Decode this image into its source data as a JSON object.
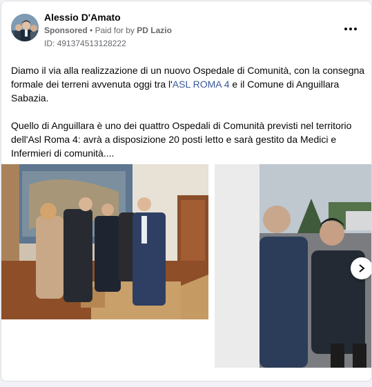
{
  "post": {
    "author": "Alessio D'Amato",
    "sponsored": "Sponsored",
    "separator": "•",
    "paid_for_by": "Paid for by",
    "payer": "PD Lazio",
    "ad_id": "ID: 491374513128222",
    "paragraph1_part1": "Diamo il via alla realizzazione di un nuovo Ospedale di Comunità, con la consegna formale dei terreni avvenuta oggi tra l'",
    "paragraph1_link": "ASL ROMA 4",
    "paragraph1_part2": " e il Comune di Anguillara Sabazia.",
    "paragraph2": "Quello di Anguillara è uno dei quattro Ospedali di Comunità previsti nel territorio dell'Asl Roma 4: avrà a disposizione 20 posti letto e sarà gestito da Medici e Infermieri di comunità...."
  },
  "icons": {
    "more": "more-options-icon",
    "next": "chevron-right-icon"
  },
  "colors": {
    "link": "#385898",
    "text": "#050505",
    "secondary": "#65676b"
  }
}
